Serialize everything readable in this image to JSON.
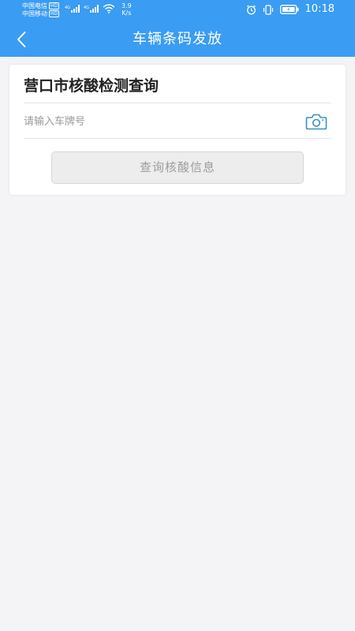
{
  "status_bar": {
    "carrier_1": "中国电信",
    "carrier_2": "中国移动",
    "hd_badge": "HD",
    "network_type": "4G",
    "speed_value": "3.9",
    "speed_unit": "K/s",
    "time": "10:18",
    "icons": [
      "signal-icon",
      "wifi-icon",
      "alarm-icon",
      "vibrate-icon",
      "battery-icon"
    ]
  },
  "header": {
    "title": "车辆条码发放",
    "back_icon": "chevron-left-icon",
    "background_color": "#3a9cf2"
  },
  "query_card": {
    "title": "营口市核酸检测查询",
    "plate_input": {
      "value": "",
      "placeholder": "请输入车牌号"
    },
    "camera_icon": "camera-icon",
    "camera_color": "#3a8fc4",
    "query_button_label": "查询核酸信息"
  }
}
